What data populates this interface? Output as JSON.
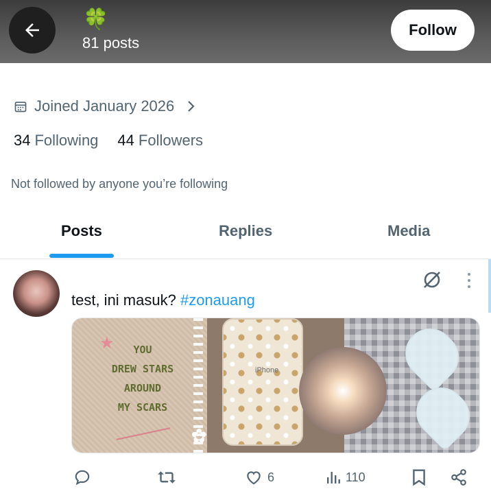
{
  "header": {
    "back_label": "Back",
    "profile_emoji": "🍀",
    "post_count": "81 posts",
    "follow_label": "Follow",
    "colors": {
      "bg_top": "#3c3c3c",
      "bg_bottom": "#6b6b6b"
    }
  },
  "profile": {
    "joined_text": "Joined January 2026",
    "following_count": "34",
    "following_label": "Following",
    "followers_count": "44",
    "followers_label": "Followers",
    "not_followed_text": "Not followed by anyone you’re following"
  },
  "tabs": [
    {
      "label": "Posts",
      "active": true
    },
    {
      "label": "Replies",
      "active": false
    },
    {
      "label": "Media",
      "active": false
    }
  ],
  "post": {
    "text": "test, ini masuk? ",
    "hashtag": "#zonauang",
    "media": {
      "image1_text_line1": "YOU",
      "image1_text_line2": "DREW STARS",
      "image1_text_line3": "AROUND",
      "image1_text_line4": "MY SCARS",
      "image2_text": "iPhone"
    },
    "actions": {
      "like_count": "6",
      "view_count": "110"
    }
  },
  "colors": {
    "accent": "#1d9bf0",
    "secondary_text": "#536471",
    "primary_text": "#0f1419"
  },
  "icons": [
    "back-arrow-icon",
    "clover-emoji",
    "calendar-icon",
    "chevron-right-icon",
    "grok-icon",
    "more-icon",
    "reply-icon",
    "repost-icon",
    "like-icon",
    "views-icon",
    "bookmark-icon",
    "share-icon"
  ]
}
